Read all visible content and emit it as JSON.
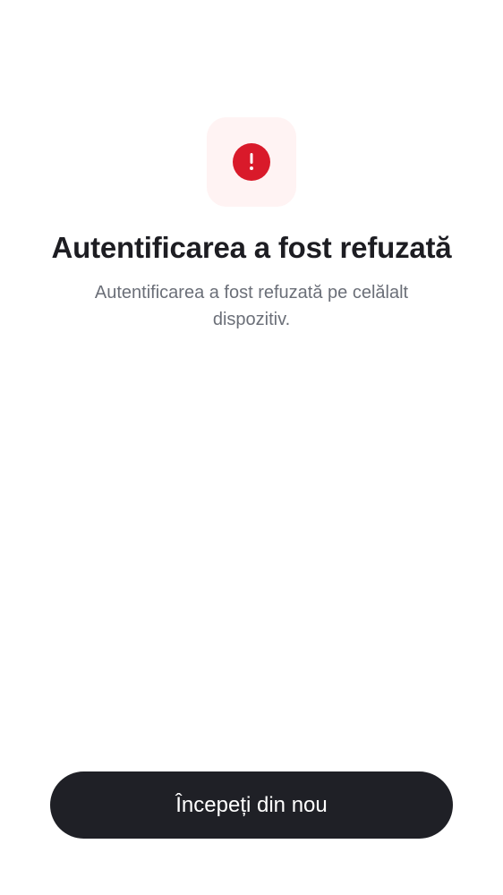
{
  "status_icon": {
    "name": "alert-exclamation-icon",
    "color": "#d91a2a",
    "background": "#fff3f3"
  },
  "title": "Autentificarea a fost refuzată",
  "subtitle": "Autentificarea a fost refuzată pe celălalt dispozitiv.",
  "actions": {
    "restart_label": "Începeți din nou"
  }
}
